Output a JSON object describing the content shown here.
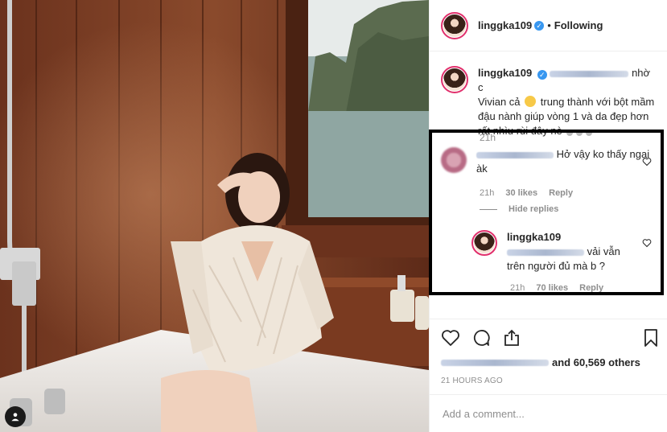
{
  "post": {
    "username": "linggka109",
    "follow_status": "Following",
    "separator": "•",
    "caption": {
      "username": "linggka109",
      "text_part1": "nhờ c",
      "text_part2": "Vivian cả",
      "text_part3": "trung thành với bột mầm đậu nành giúp vòng 1 và da đẹp hơn rất nhìu rùi đây nè",
      "time": "21h"
    },
    "comments": [
      {
        "text": "Hở vậy ko thấy ngại àk",
        "time": "21h",
        "likes": "30 likes",
        "reply_label": "Reply",
        "hide_replies_label": "Hide replies"
      }
    ],
    "reply": {
      "username": "linggka109",
      "text_part1": "vải vẫn",
      "text_part2": "trên người đủ mà b ?",
      "time": "21h",
      "likes": "70 likes",
      "reply_label": "Reply"
    },
    "likes_text": "and 60,569 others",
    "timestamp": "21 HOURS AGO",
    "add_comment_placeholder": "Add a comment..."
  },
  "icons": {
    "verified": "verified-badge-icon",
    "like": "heart-icon",
    "comment": "comment-bubble-icon",
    "share": "share-icon",
    "save": "bookmark-icon",
    "small_like": "small-heart-icon",
    "photo_badge": "user-tag-icon"
  },
  "colors": {
    "accent_blue": "#3897f0",
    "highlight_border": "#000000",
    "text_primary": "#262626",
    "text_secondary": "#8e8e8e"
  }
}
